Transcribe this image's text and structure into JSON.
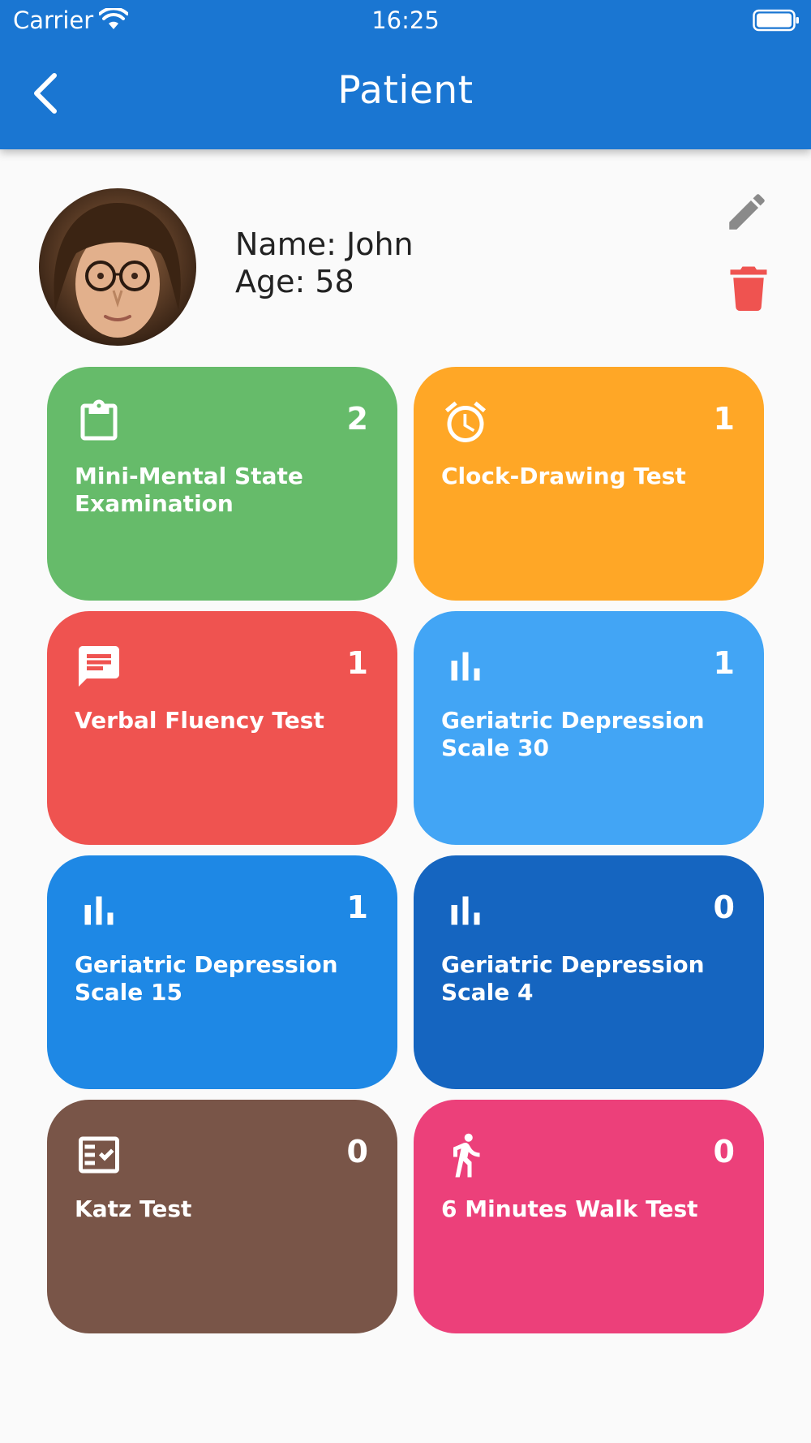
{
  "status_bar": {
    "carrier": "Carrier",
    "time": "16:25"
  },
  "app_bar": {
    "title": "Patient",
    "color": "#1a76d2"
  },
  "patient": {
    "name_line": "Name: John",
    "age_line": "Age: 58"
  },
  "actions": {
    "edit_color": "#8a8a8a",
    "delete_color": "#ef5350"
  },
  "tests": [
    {
      "label": "Mini-Mental State Examination",
      "count": "2",
      "icon": "clipboard-icon",
      "color": "#66bb6a"
    },
    {
      "label": "Clock-Drawing Test",
      "count": "1",
      "icon": "alarm-clock-icon",
      "color": "#ffa726"
    },
    {
      "label": "Verbal Fluency Test",
      "count": "1",
      "icon": "chat-message-icon",
      "color": "#ef5350"
    },
    {
      "label": "Geriatric Depression Scale 30",
      "count": "1",
      "icon": "bar-chart-icon",
      "color": "#42a5f5"
    },
    {
      "label": "Geriatric Depression Scale 15",
      "count": "1",
      "icon": "bar-chart-icon",
      "color": "#1e88e5"
    },
    {
      "label": "Geriatric Depression Scale 4",
      "count": "0",
      "icon": "bar-chart-icon",
      "color": "#1565c0"
    },
    {
      "label": "Katz Test",
      "count": "0",
      "icon": "checklist-icon",
      "color": "#795548"
    },
    {
      "label": "6 Minutes Walk Test",
      "count": "0",
      "icon": "walking-person-icon",
      "color": "#ec407a"
    }
  ]
}
